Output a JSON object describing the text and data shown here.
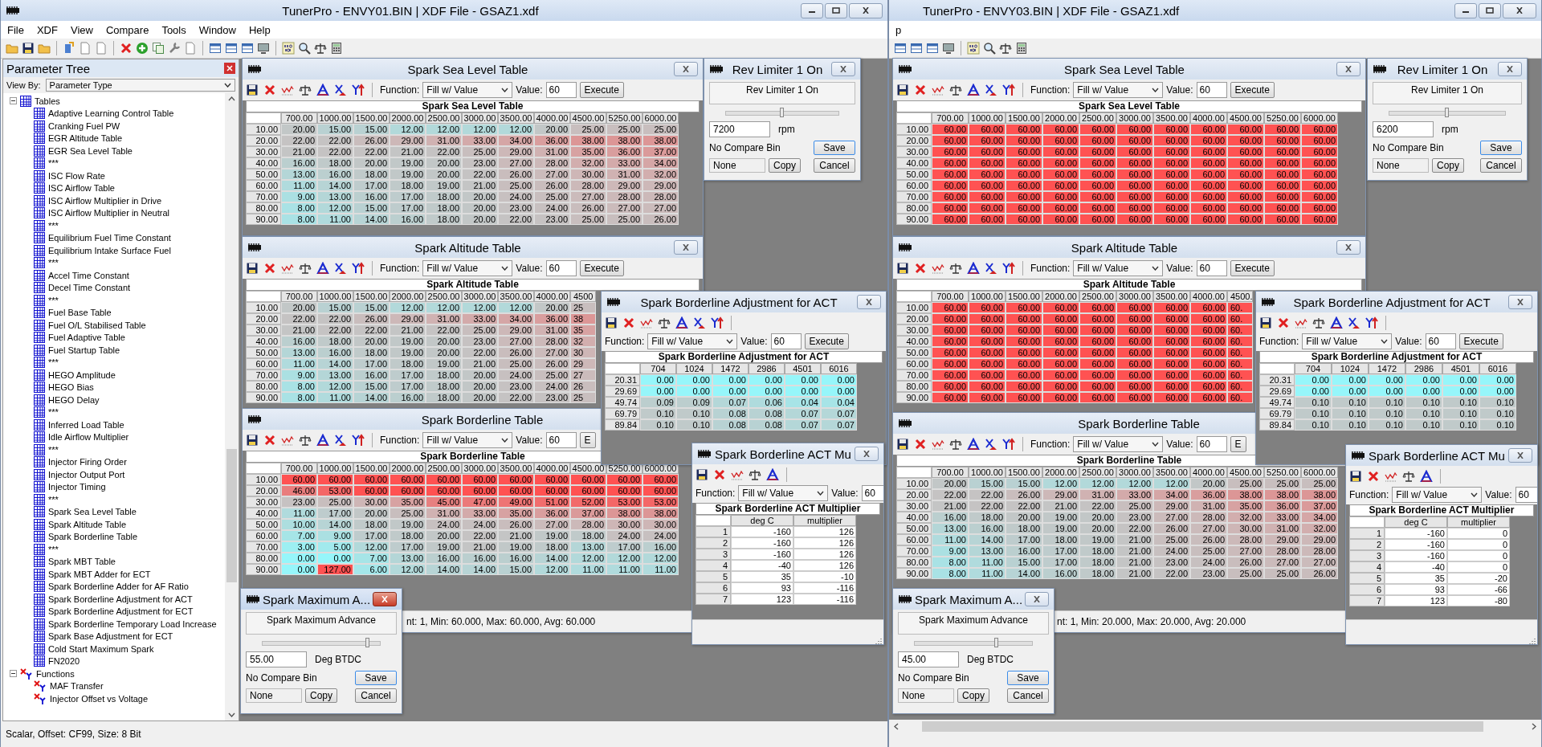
{
  "apps": [
    {
      "title": "TunerPro - ENVY01.BIN | XDF File - GSAZ1.xdf",
      "menu": [
        "File",
        "XDF",
        "View",
        "Compare",
        "Tools",
        "Window",
        "Help"
      ],
      "parameter_tree": {
        "title": "Parameter Tree",
        "view_by_label": "View By:",
        "view_by": "Parameter Type",
        "nodes": [
          {
            "label": "Tables",
            "kind": "table",
            "expanded": true,
            "children": [
              {
                "label": "Adaptive Learning Control Table",
                "kind": "table"
              },
              {
                "label": "Cranking Fuel PW",
                "kind": "table"
              },
              {
                "label": "EGR Altitude Table",
                "kind": "table"
              },
              {
                "label": "EGR Sea Level Table",
                "kind": "table"
              },
              {
                "label": "***",
                "kind": "table"
              },
              {
                "label": "ISC Flow Rate",
                "kind": "table"
              },
              {
                "label": "ISC Airflow Table",
                "kind": "table"
              },
              {
                "label": "ISC Airflow Multiplier in Drive",
                "kind": "table"
              },
              {
                "label": "ISC Airflow Multiplier in Neutral",
                "kind": "table"
              },
              {
                "label": "***",
                "kind": "table"
              },
              {
                "label": "Equilibrium Fuel Time Constant",
                "kind": "table"
              },
              {
                "label": "Equilibrium Intake Surface Fuel",
                "kind": "table"
              },
              {
                "label": "***",
                "kind": "table"
              },
              {
                "label": "Accel Time Constant",
                "kind": "table"
              },
              {
                "label": "Decel Time Constant",
                "kind": "table"
              },
              {
                "label": "***",
                "kind": "table"
              },
              {
                "label": "Fuel Base Table",
                "kind": "table"
              },
              {
                "label": "Fuel O/L Stabilised Table",
                "kind": "table"
              },
              {
                "label": "Fuel Adaptive Table",
                "kind": "table"
              },
              {
                "label": "Fuel Startup Table",
                "kind": "table"
              },
              {
                "label": "***",
                "kind": "table"
              },
              {
                "label": "HEGO Amplitude",
                "kind": "table"
              },
              {
                "label": "HEGO Bias",
                "kind": "table"
              },
              {
                "label": "HEGO Delay",
                "kind": "table"
              },
              {
                "label": "***",
                "kind": "table"
              },
              {
                "label": "Inferred Load Table",
                "kind": "table"
              },
              {
                "label": "Idle Airflow Multiplier",
                "kind": "table"
              },
              {
                "label": "***",
                "kind": "table"
              },
              {
                "label": "Injector Firing Order",
                "kind": "table"
              },
              {
                "label": "Injector Output Port",
                "kind": "table"
              },
              {
                "label": "Injector Timing",
                "kind": "table"
              },
              {
                "label": "***",
                "kind": "table"
              },
              {
                "label": "Spark Sea Level Table",
                "kind": "table"
              },
              {
                "label": "Spark Altitude Table",
                "kind": "table"
              },
              {
                "label": "Spark Borderline Table",
                "kind": "table"
              },
              {
                "label": "***",
                "kind": "table"
              },
              {
                "label": "Spark MBT Table",
                "kind": "table"
              },
              {
                "label": "Spark MBT Adder for ECT",
                "kind": "table"
              },
              {
                "label": "Spark Borderline Adder for AF Ratio",
                "kind": "table"
              },
              {
                "label": "Spark Borderline Adjustment for ACT",
                "kind": "table"
              },
              {
                "label": "Spark Borderline Adjustment for ECT",
                "kind": "table"
              },
              {
                "label": "Spark Borderline Temporary Load Increase",
                "kind": "table"
              },
              {
                "label": "Spark Base Adjustment for ECT",
                "kind": "table"
              },
              {
                "label": "Cold Start Maximum Spark",
                "kind": "table"
              },
              {
                "label": "FN2020",
                "kind": "table"
              }
            ]
          },
          {
            "label": "Functions",
            "kind": "function",
            "expanded": true,
            "children": [
              {
                "label": "MAF Transfer",
                "kind": "function"
              },
              {
                "label": "Injector Offset vs Voltage",
                "kind": "function"
              }
            ]
          }
        ]
      },
      "status": "Scalar, Offset: CF99,  Size: 8 Bit",
      "windows": [
        {
          "kind": "table",
          "title": "Spark Sea Level Table",
          "active": false,
          "function_label": "Function:",
          "function": "Fill w/ Value",
          "value_label": "Value:",
          "value": "60",
          "execute": "Execute",
          "table_title": "Spark Sea Level Table",
          "columns": [
            "700.00",
            "1000.00",
            "1500.00",
            "2000.00",
            "2500.00",
            "3000.00",
            "3500.00",
            "4000.00",
            "4500.00",
            "5250.00",
            "6000.00"
          ],
          "rows": [
            {
              "label": "10.00",
              "cells": [
                "20.00",
                "15.00",
                "15.00",
                "12.00",
                "12.00",
                "12.00",
                "12.00",
                "20.00",
                "25.00",
                "25.00",
                "25.00"
              ]
            },
            {
              "label": "20.00",
              "cells": [
                "22.00",
                "22.00",
                "26.00",
                "29.00",
                "31.00",
                "33.00",
                "34.00",
                "36.00",
                "38.00",
                "38.00",
                "38.00"
              ]
            },
            {
              "label": "30.00",
              "cells": [
                "21.00",
                "22.00",
                "22.00",
                "21.00",
                "22.00",
                "25.00",
                "29.00",
                "31.00",
                "35.00",
                "36.00",
                "37.00"
              ]
            },
            {
              "label": "40.00",
              "cells": [
                "16.00",
                "18.00",
                "20.00",
                "19.00",
                "20.00",
                "23.00",
                "27.00",
                "28.00",
                "32.00",
                "33.00",
                "34.00"
              ]
            },
            {
              "label": "50.00",
              "cells": [
                "13.00",
                "16.00",
                "18.00",
                "19.00",
                "20.00",
                "22.00",
                "26.00",
                "27.00",
                "30.00",
                "31.00",
                "32.00"
              ]
            },
            {
              "label": "60.00",
              "cells": [
                "11.00",
                "14.00",
                "17.00",
                "18.00",
                "19.00",
                "21.00",
                "25.00",
                "26.00",
                "28.00",
                "29.00",
                "29.00"
              ]
            },
            {
              "label": "70.00",
              "cells": [
                "9.00",
                "13.00",
                "16.00",
                "17.00",
                "18.00",
                "20.00",
                "24.00",
                "25.00",
                "27.00",
                "28.00",
                "28.00"
              ]
            },
            {
              "label": "80.00",
              "cells": [
                "8.00",
                "12.00",
                "15.00",
                "17.00",
                "18.00",
                "20.00",
                "23.00",
                "24.00",
                "26.00",
                "27.00",
                "27.00"
              ]
            },
            {
              "label": "90.00",
              "cells": [
                "8.00",
                "11.00",
                "14.00",
                "16.00",
                "18.00",
                "20.00",
                "22.00",
                "23.00",
                "25.00",
                "25.00",
                "26.00"
              ]
            }
          ]
        },
        {
          "kind": "scalar",
          "title": "Rev Limiter 1 On",
          "active": false,
          "label": "Rev Limiter 1 On",
          "level": 0.5,
          "value": "7200",
          "unit": "rpm",
          "compare": "No Compare Bin",
          "compare_value": "None",
          "copy": "Copy",
          "save": "Save",
          "cancel": "Cancel"
        },
        {
          "kind": "table",
          "title": "Spark Altitude Table",
          "active": false,
          "function_label": "Function:",
          "function": "Fill w/ Value",
          "value_label": "Value:",
          "value": "60",
          "execute": "Execute",
          "table_title": "Spark Altitude Table",
          "columns": [
            "700.00",
            "1000.00",
            "1500.00",
            "2000.00",
            "2500.00",
            "3000.00",
            "3500.00",
            "4000.00"
          ],
          "partial_column": {
            "label": "4500",
            "cells": [
              "25",
              "38",
              "35",
              "32",
              "30",
              "29",
              "27",
              "26",
              "25"
            ]
          },
          "rows": [
            {
              "label": "10.00",
              "cells": [
                "20.00",
                "15.00",
                "15.00",
                "12.00",
                "12.00",
                "12.00",
                "12.00",
                "20.00"
              ]
            },
            {
              "label": "20.00",
              "cells": [
                "22.00",
                "22.00",
                "26.00",
                "29.00",
                "31.00",
                "33.00",
                "34.00",
                "36.00"
              ]
            },
            {
              "label": "30.00",
              "cells": [
                "21.00",
                "22.00",
                "22.00",
                "21.00",
                "22.00",
                "25.00",
                "29.00",
                "31.00"
              ]
            },
            {
              "label": "40.00",
              "cells": [
                "16.00",
                "18.00",
                "20.00",
                "19.00",
                "20.00",
                "23.00",
                "27.00",
                "28.00"
              ]
            },
            {
              "label": "50.00",
              "cells": [
                "13.00",
                "16.00",
                "18.00",
                "19.00",
                "20.00",
                "22.00",
                "26.00",
                "27.00"
              ]
            },
            {
              "label": "60.00",
              "cells": [
                "11.00",
                "14.00",
                "17.00",
                "18.00",
                "19.00",
                "21.00",
                "25.00",
                "26.00"
              ]
            },
            {
              "label": "70.00",
              "cells": [
                "9.00",
                "13.00",
                "16.00",
                "17.00",
                "18.00",
                "20.00",
                "24.00",
                "25.00"
              ]
            },
            {
              "label": "80.00",
              "cells": [
                "8.00",
                "12.00",
                "15.00",
                "17.00",
                "18.00",
                "20.00",
                "23.00",
                "24.00"
              ]
            },
            {
              "label": "90.00",
              "cells": [
                "8.00",
                "11.00",
                "14.00",
                "16.00",
                "18.00",
                "20.00",
                "22.00",
                "23.00"
              ]
            }
          ]
        },
        {
          "kind": "table",
          "title": "Spark Borderline Table",
          "active": false,
          "function_label": "Function:",
          "function": "Fill w/ Value",
          "value_label": "Value:",
          "value": "60",
          "execute": "E",
          "table_title": "Spark Borderline Table",
          "columns": [
            "700.00",
            "1000.00",
            "1500.00",
            "2000.00",
            "2500.00",
            "3000.00",
            "3500.00",
            "4000.00",
            "4500.00",
            "5250.00",
            "6000.00"
          ],
          "rows": [
            {
              "label": "10.00",
              "cells": [
                "60.00",
                "60.00",
                "60.00",
                "60.00",
                "60.00",
                "60.00",
                "60.00",
                "60.00",
                "60.00",
                "60.00",
                "60.00"
              ]
            },
            {
              "label": "20.00",
              "cells": [
                "46.00",
                "53.00",
                "60.00",
                "60.00",
                "60.00",
                "60.00",
                "60.00",
                "60.00",
                "60.00",
                "60.00",
                "60.00"
              ]
            },
            {
              "label": "30.00",
              "cells": [
                "23.00",
                "25.00",
                "30.00",
                "35.00",
                "45.00",
                "47.00",
                "49.00",
                "51.00",
                "52.00",
                "53.00",
                "53.00"
              ]
            },
            {
              "label": "40.00",
              "cells": [
                "11.00",
                "17.00",
                "20.00",
                "25.00",
                "31.00",
                "33.00",
                "35.00",
                "36.00",
                "37.00",
                "38.00",
                "38.00"
              ]
            },
            {
              "label": "50.00",
              "cells": [
                "10.00",
                "14.00",
                "18.00",
                "19.00",
                "24.00",
                "24.00",
                "26.00",
                "27.00",
                "28.00",
                "30.00",
                "30.00"
              ]
            },
            {
              "label": "60.00",
              "cells": [
                "7.00",
                "9.00",
                "17.00",
                "18.00",
                "20.00",
                "22.00",
                "21.00",
                "19.00",
                "18.00",
                "24.00",
                "24.00"
              ]
            },
            {
              "label": "70.00",
              "cells": [
                "3.00",
                "5.00",
                "12.00",
                "17.00",
                "19.00",
                "21.00",
                "19.00",
                "18.00",
                "13.00",
                "17.00",
                "16.00"
              ]
            },
            {
              "label": "80.00",
              "cells": [
                "0.00",
                "0.00",
                "7.00",
                "13.00",
                "16.00",
                "16.00",
                "16.00",
                "14.00",
                "12.00",
                "12.00",
                "12.00"
              ]
            },
            {
              "label": "90.00",
              "cells": [
                "0.00",
                "127.00",
                "6.00",
                "12.00",
                "14.00",
                "14.00",
                "15.00",
                "12.00",
                "11.00",
                "11.00",
                "11.00"
              ]
            }
          ],
          "status": "nt: 1, Min: 60.000, Max: 60.000, Avg: 60.000"
        },
        {
          "kind": "table",
          "title": "Spark Borderline Adjustment for ACT",
          "active": false,
          "function_label": "Function:",
          "function": "Fill w/ Value",
          "value_label": "Value:",
          "value": "60",
          "execute": "Execute",
          "table_title": "Spark Borderline Adjustment for ACT",
          "columns": [
            "704",
            "1024",
            "1472",
            "2986",
            "4501",
            "6016"
          ],
          "rows": [
            {
              "label": "20.31",
              "cells": [
                "0.00",
                "0.00",
                "0.00",
                "0.00",
                "0.00",
                "0.00"
              ]
            },
            {
              "label": "29.69",
              "cells": [
                "0.00",
                "0.00",
                "0.00",
                "0.00",
                "0.00",
                "0.00"
              ]
            },
            {
              "label": "49.74",
              "cells": [
                "0.09",
                "0.09",
                "0.07",
                "0.06",
                "0.04",
                "0.04"
              ]
            },
            {
              "label": "69.79",
              "cells": [
                "0.10",
                "0.10",
                "0.08",
                "0.08",
                "0.07",
                "0.07"
              ]
            },
            {
              "label": "89.84",
              "cells": [
                "0.10",
                "0.10",
                "0.08",
                "0.08",
                "0.07",
                "0.07"
              ]
            }
          ]
        },
        {
          "kind": "function",
          "title": "Spark Borderline ACT Mu",
          "active": false,
          "function_label": "Function:",
          "function": "Fill w/ Value",
          "value_label": "Value:",
          "value": "60",
          "table_title": "Spark Borderline ACT Multiplier",
          "columns": [
            "deg C",
            "multiplier"
          ],
          "rows": [
            {
              "label": "1",
              "cells": [
                "-160",
                "126"
              ]
            },
            {
              "label": "2",
              "cells": [
                "-160",
                "126"
              ]
            },
            {
              "label": "3",
              "cells": [
                "-160",
                "126"
              ]
            },
            {
              "label": "4",
              "cells": [
                "-40",
                "126"
              ]
            },
            {
              "label": "5",
              "cells": [
                "35",
                "-10"
              ]
            },
            {
              "label": "6",
              "cells": [
                "93",
                "-116"
              ]
            },
            {
              "label": "7",
              "cells": [
                "123",
                "-116"
              ]
            }
          ]
        },
        {
          "kind": "scalar",
          "title": "Spark Maximum A...",
          "active": true,
          "label": "Spark Maximum Advance",
          "level": 0.9,
          "value": "55.00",
          "unit": "Deg BTDC",
          "compare": "No Compare Bin",
          "compare_value": "None",
          "copy": "Copy",
          "save": "Save",
          "cancel": "Cancel"
        }
      ]
    },
    {
      "title": "TunerPro - ENVY03.BIN | XDF File - GSAZ1.xdf",
      "menu": [
        "p"
      ],
      "windows": [
        {
          "kind": "table",
          "title": "Spark Sea Level Table",
          "active": false,
          "function_label": "Function:",
          "function": "Fill w/ Value",
          "value_label": "Value:",
          "value": "60",
          "execute": "Execute",
          "table_title": "Spark Sea Level Table",
          "columns": [
            "700.00",
            "1000.00",
            "1500.00",
            "2000.00",
            "2500.00",
            "3000.00",
            "3500.00",
            "4000.00",
            "4500.00",
            "5250.00",
            "6000.00"
          ],
          "rows": [
            {
              "label": "10.00",
              "cells": [
                "60.00",
                "60.00",
                "60.00",
                "60.00",
                "60.00",
                "60.00",
                "60.00",
                "60.00",
                "60.00",
                "60.00",
                "60.00"
              ]
            },
            {
              "label": "20.00",
              "cells": [
                "60.00",
                "60.00",
                "60.00",
                "60.00",
                "60.00",
                "60.00",
                "60.00",
                "60.00",
                "60.00",
                "60.00",
                "60.00"
              ]
            },
            {
              "label": "30.00",
              "cells": [
                "60.00",
                "60.00",
                "60.00",
                "60.00",
                "60.00",
                "60.00",
                "60.00",
                "60.00",
                "60.00",
                "60.00",
                "60.00"
              ]
            },
            {
              "label": "40.00",
              "cells": [
                "60.00",
                "60.00",
                "60.00",
                "60.00",
                "60.00",
                "60.00",
                "60.00",
                "60.00",
                "60.00",
                "60.00",
                "60.00"
              ]
            },
            {
              "label": "50.00",
              "cells": [
                "60.00",
                "60.00",
                "60.00",
                "60.00",
                "60.00",
                "60.00",
                "60.00",
                "60.00",
                "60.00",
                "60.00",
                "60.00"
              ]
            },
            {
              "label": "60.00",
              "cells": [
                "60.00",
                "60.00",
                "60.00",
                "60.00",
                "60.00",
                "60.00",
                "60.00",
                "60.00",
                "60.00",
                "60.00",
                "60.00"
              ]
            },
            {
              "label": "70.00",
              "cells": [
                "60.00",
                "60.00",
                "60.00",
                "60.00",
                "60.00",
                "60.00",
                "60.00",
                "60.00",
                "60.00",
                "60.00",
                "60.00"
              ]
            },
            {
              "label": "80.00",
              "cells": [
                "60.00",
                "60.00",
                "60.00",
                "60.00",
                "60.00",
                "60.00",
                "60.00",
                "60.00",
                "60.00",
                "60.00",
                "60.00"
              ]
            },
            {
              "label": "90.00",
              "cells": [
                "60.00",
                "60.00",
                "60.00",
                "60.00",
                "60.00",
                "60.00",
                "60.00",
                "60.00",
                "60.00",
                "60.00",
                "60.00"
              ]
            }
          ]
        },
        {
          "kind": "scalar",
          "title": "Rev Limiter 1 On",
          "active": false,
          "label": "Rev Limiter 1 On",
          "level": 0.5,
          "value": "6200",
          "unit": "rpm",
          "compare": "No Compare Bin",
          "compare_value": "None",
          "copy": "Copy",
          "save": "Save",
          "cancel": "Cancel"
        },
        {
          "kind": "table",
          "title": "Spark Altitude Table",
          "active": false,
          "function_label": "Function:",
          "function": "Fill w/ Value",
          "value_label": "Value:",
          "value": "60",
          "execute": "Execute",
          "table_title": "Spark Altitude Table",
          "columns": [
            "700.00",
            "1000.00",
            "1500.00",
            "2000.00",
            "2500.00",
            "3000.00",
            "3500.00",
            "4000.00"
          ],
          "partial_column": {
            "label": "4500.",
            "cells": [
              "60.",
              "60.",
              "60.",
              "60.",
              "60.",
              "60.",
              "60.",
              "60.",
              "60."
            ]
          },
          "rows": [
            {
              "label": "10.00",
              "cells": [
                "60.00",
                "60.00",
                "60.00",
                "60.00",
                "60.00",
                "60.00",
                "60.00",
                "60.00"
              ]
            },
            {
              "label": "20.00",
              "cells": [
                "60.00",
                "60.00",
                "60.00",
                "60.00",
                "60.00",
                "60.00",
                "60.00",
                "60.00"
              ]
            },
            {
              "label": "30.00",
              "cells": [
                "60.00",
                "60.00",
                "60.00",
                "60.00",
                "60.00",
                "60.00",
                "60.00",
                "60.00"
              ]
            },
            {
              "label": "40.00",
              "cells": [
                "60.00",
                "60.00",
                "60.00",
                "60.00",
                "60.00",
                "60.00",
                "60.00",
                "60.00"
              ]
            },
            {
              "label": "50.00",
              "cells": [
                "60.00",
                "60.00",
                "60.00",
                "60.00",
                "60.00",
                "60.00",
                "60.00",
                "60.00"
              ]
            },
            {
              "label": "60.00",
              "cells": [
                "60.00",
                "60.00",
                "60.00",
                "60.00",
                "60.00",
                "60.00",
                "60.00",
                "60.00"
              ]
            },
            {
              "label": "70.00",
              "cells": [
                "60.00",
                "60.00",
                "60.00",
                "60.00",
                "60.00",
                "60.00",
                "60.00",
                "60.00"
              ]
            },
            {
              "label": "80.00",
              "cells": [
                "60.00",
                "60.00",
                "60.00",
                "60.00",
                "60.00",
                "60.00",
                "60.00",
                "60.00"
              ]
            },
            {
              "label": "90.00",
              "cells": [
                "60.00",
                "60.00",
                "60.00",
                "60.00",
                "60.00",
                "60.00",
                "60.00",
                "60.00"
              ]
            }
          ]
        },
        {
          "kind": "table",
          "title": "Spark Borderline Table",
          "active": false,
          "function_label": "Function:",
          "function": "Fill w/ Value",
          "value_label": "Value:",
          "value": "60",
          "execute": "E",
          "table_title": "Spark Borderline Table",
          "columns": [
            "700.00",
            "1000.00",
            "1500.00",
            "2000.00",
            "2500.00",
            "3000.00",
            "3500.00",
            "4000.00",
            "4500.00",
            "5250.00",
            "6000.00"
          ],
          "rows": [
            {
              "label": "10.00",
              "cells": [
                "20.00",
                "15.00",
                "15.00",
                "12.00",
                "12.00",
                "12.00",
                "12.00",
                "20.00",
                "25.00",
                "25.00",
                "25.00"
              ]
            },
            {
              "label": "20.00",
              "cells": [
                "22.00",
                "22.00",
                "26.00",
                "29.00",
                "31.00",
                "33.00",
                "34.00",
                "36.00",
                "38.00",
                "38.00",
                "38.00"
              ]
            },
            {
              "label": "30.00",
              "cells": [
                "21.00",
                "22.00",
                "22.00",
                "21.00",
                "22.00",
                "25.00",
                "29.00",
                "31.00",
                "35.00",
                "36.00",
                "37.00"
              ]
            },
            {
              "label": "40.00",
              "cells": [
                "16.00",
                "18.00",
                "20.00",
                "19.00",
                "20.00",
                "23.00",
                "27.00",
                "28.00",
                "32.00",
                "33.00",
                "34.00"
              ]
            },
            {
              "label": "50.00",
              "cells": [
                "13.00",
                "16.00",
                "18.00",
                "19.00",
                "20.00",
                "22.00",
                "26.00",
                "27.00",
                "30.00",
                "31.00",
                "32.00"
              ]
            },
            {
              "label": "60.00",
              "cells": [
                "11.00",
                "14.00",
                "17.00",
                "18.00",
                "19.00",
                "21.00",
                "25.00",
                "26.00",
                "28.00",
                "29.00",
                "29.00"
              ]
            },
            {
              "label": "70.00",
              "cells": [
                "9.00",
                "13.00",
                "16.00",
                "17.00",
                "18.00",
                "21.00",
                "24.00",
                "25.00",
                "27.00",
                "28.00",
                "28.00"
              ]
            },
            {
              "label": "80.00",
              "cells": [
                "8.00",
                "11.00",
                "15.00",
                "17.00",
                "18.00",
                "21.00",
                "23.00",
                "24.00",
                "26.00",
                "27.00",
                "27.00"
              ]
            },
            {
              "label": "90.00",
              "cells": [
                "8.00",
                "11.00",
                "14.00",
                "16.00",
                "18.00",
                "21.00",
                "22.00",
                "23.00",
                "25.00",
                "25.00",
                "26.00"
              ]
            }
          ],
          "status": "nt: 1, Min: 20.000, Max: 20.000, Avg: 20.000"
        },
        {
          "kind": "table",
          "title": "Spark Borderline Adjustment for ACT",
          "active": false,
          "function_label": "Function:",
          "function": "Fill w/ Value",
          "value_label": "Value:",
          "value": "60",
          "execute": "Execute",
          "table_title": "Spark Borderline Adjustment for ACT",
          "columns": [
            "704",
            "1024",
            "1472",
            "2986",
            "4501",
            "6016"
          ],
          "rows": [
            {
              "label": "20.31",
              "cells": [
                "0.00",
                "0.00",
                "0.00",
                "0.00",
                "0.00",
                "0.00"
              ]
            },
            {
              "label": "29.69",
              "cells": [
                "0.00",
                "0.00",
                "0.00",
                "0.00",
                "0.00",
                "0.00"
              ]
            },
            {
              "label": "49.74",
              "cells": [
                "0.10",
                "0.10",
                "0.10",
                "0.10",
                "0.10",
                "0.10"
              ]
            },
            {
              "label": "69.79",
              "cells": [
                "0.10",
                "0.10",
                "0.10",
                "0.10",
                "0.10",
                "0.10"
              ]
            },
            {
              "label": "89.84",
              "cells": [
                "0.10",
                "0.10",
                "0.10",
                "0.10",
                "0.10",
                "0.10"
              ]
            }
          ]
        },
        {
          "kind": "function",
          "title": "Spark Borderline ACT Mu",
          "active": false,
          "function_label": "Function:",
          "function": "Fill w/ Value",
          "value_label": "Value:",
          "value": "60",
          "table_title": "Spark Borderline ACT Multiplier",
          "columns": [
            "deg C",
            "multiplier"
          ],
          "rows": [
            {
              "label": "1",
              "cells": [
                "-160",
                "0"
              ]
            },
            {
              "label": "2",
              "cells": [
                "-160",
                "0"
              ]
            },
            {
              "label": "3",
              "cells": [
                "-160",
                "0"
              ]
            },
            {
              "label": "4",
              "cells": [
                "-40",
                "0"
              ]
            },
            {
              "label": "5",
              "cells": [
                "35",
                "-20"
              ]
            },
            {
              "label": "6",
              "cells": [
                "93",
                "-66"
              ]
            },
            {
              "label": "7",
              "cells": [
                "123",
                "-80"
              ]
            }
          ]
        },
        {
          "kind": "scalar",
          "title": "Spark Maximum A...",
          "active": false,
          "label": "Spark Maximum Advance",
          "level": 0.7,
          "value": "45.00",
          "unit": "Deg BTDC",
          "compare": "No Compare Bin",
          "compare_value": "None",
          "copy": "Copy",
          "save": "Save",
          "cancel": "Cancel"
        }
      ]
    }
  ]
}
